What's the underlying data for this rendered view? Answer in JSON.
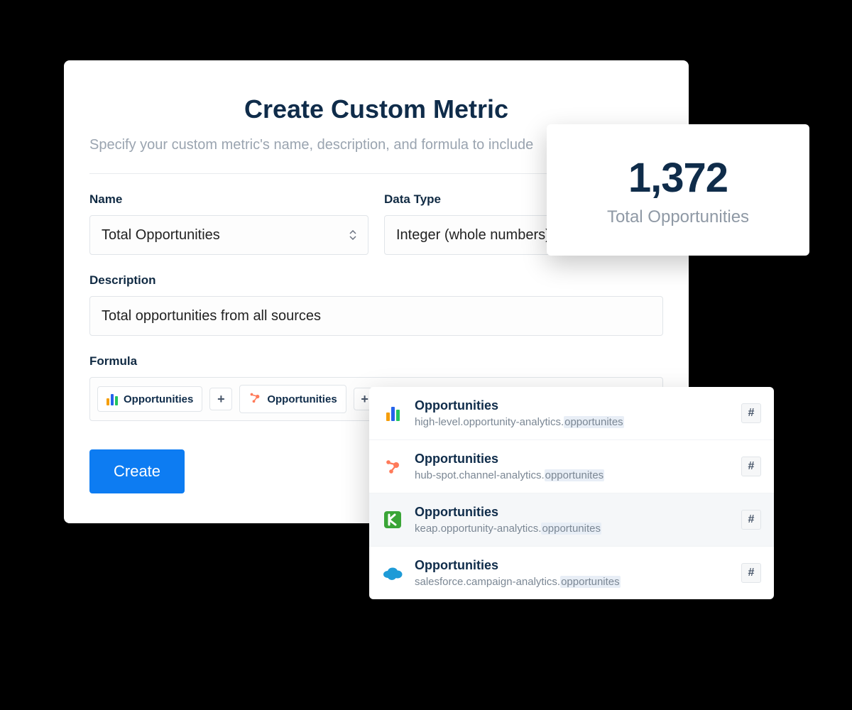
{
  "header": {
    "title": "Create Custom Metric",
    "subtitle": "Specify your custom metric's name, description, and formula to include"
  },
  "fields": {
    "name_label": "Name",
    "name_value": "Total Opportunities",
    "datatype_label": "Data Type",
    "datatype_value": "Integer (whole numbers)",
    "description_label": "Description",
    "description_value": "Total opportunities from all sources",
    "formula_label": "Formula"
  },
  "formula": {
    "chips": [
      {
        "label": "Opportunities",
        "icon": "bars"
      },
      {
        "label": "Opportunities",
        "icon": "hubspot"
      }
    ],
    "operator": "+"
  },
  "buttons": {
    "create": "Create"
  },
  "metric_card": {
    "value": "1,372",
    "label": "Total Opportunities"
  },
  "suggestions": [
    {
      "icon": "bars",
      "name": "Opportunities",
      "path_prefix": "high-level.opportunity-analytics.",
      "path_match": "opportunites",
      "active": false
    },
    {
      "icon": "hubspot",
      "name": "Opportunities",
      "path_prefix": "hub-spot.channel-analytics.",
      "path_match": "opportunites",
      "active": false
    },
    {
      "icon": "keap",
      "name": "Opportunities",
      "path_prefix": "keap.opportunity-analytics.",
      "path_match": "opportunites",
      "active": true
    },
    {
      "icon": "salesforce",
      "name": "Opportunities",
      "path_prefix": "salesforce.campaign-analytics.",
      "path_match": "opportunites",
      "active": false
    }
  ],
  "hash_label": "#"
}
